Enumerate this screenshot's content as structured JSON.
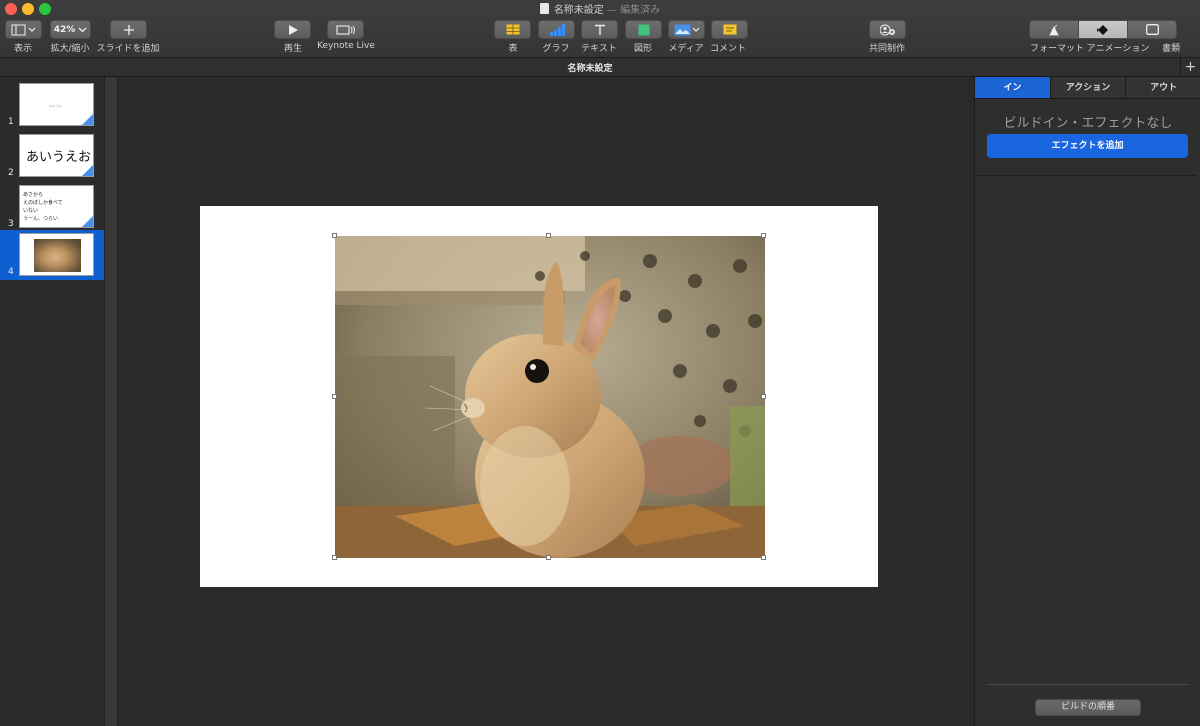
{
  "window": {
    "title": "名称未設定",
    "status": "編集済み",
    "title_separator": "—"
  },
  "toolbar": {
    "view_label": "表示",
    "zoom_value": "42%",
    "zoom_label": "拡大/縮小",
    "add_slide_label": "スライドを追加",
    "play_label": "再生",
    "keynote_live_label": "Keynote Live",
    "table_label": "表",
    "chart_label": "グラフ",
    "text_label": "テキスト",
    "shape_label": "図形",
    "media_label": "メディア",
    "comment_label": "コメント",
    "collaborate_label": "共同制作",
    "format_label": "フォーマット",
    "animate_label": "アニメーション",
    "document_label": "書類"
  },
  "tabbar": {
    "title": "名称未設定",
    "new_tab": "+"
  },
  "navigator": {
    "slides": [
      {
        "number": "1",
        "tiny_text": "ﾀｲﾄﾙ ﾃｷｽﾄ"
      },
      {
        "number": "2",
        "text": "あいうえお"
      },
      {
        "number": "3",
        "text": "あさから\nえのぼしか食べて\nいない\nうーん、つらい"
      },
      {
        "number": "4",
        "selected": true
      }
    ]
  },
  "inspector": {
    "tabs": [
      "イン",
      "アクション",
      "アウト"
    ],
    "active_tab": "イン",
    "empty_message": "ビルドイン・エフェクトなし",
    "add_effect": "エフェクトを追加",
    "build_order": "ビルドの順番"
  },
  "colors": {
    "accent": "#1a66e0",
    "selection": "#0f5fd0",
    "close": "#fd5f57",
    "minimize": "#fdbc2f",
    "maximize": "#28c840"
  }
}
